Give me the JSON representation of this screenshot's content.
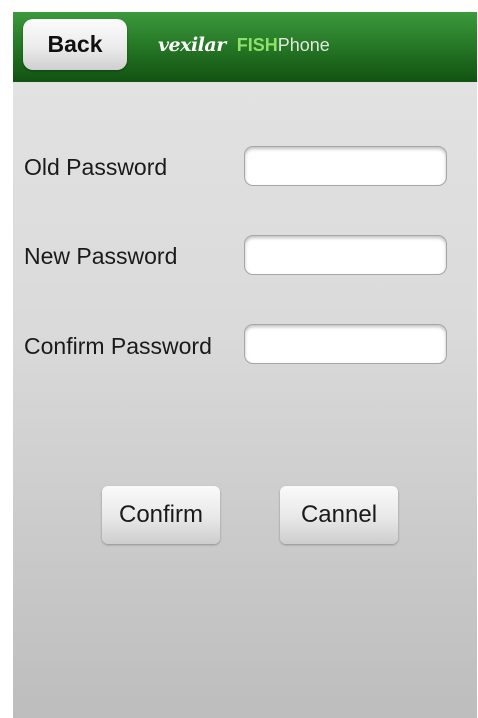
{
  "header": {
    "back_label": "Back",
    "brand_vexilar": "vexilar",
    "brand_fish": "FISH",
    "brand_phone": "Phone"
  },
  "form": {
    "old_password": {
      "label": "Old Password",
      "value": ""
    },
    "new_password": {
      "label": "New Password",
      "value": ""
    },
    "confirm_password": {
      "label": "Confirm Password",
      "value": ""
    }
  },
  "actions": {
    "confirm_label": "Confirm",
    "cancel_label": "Cannel"
  },
  "colors": {
    "header_green": "#277a27",
    "brand_fish_green": "#8fe06a",
    "background_gray": "#dadada"
  }
}
